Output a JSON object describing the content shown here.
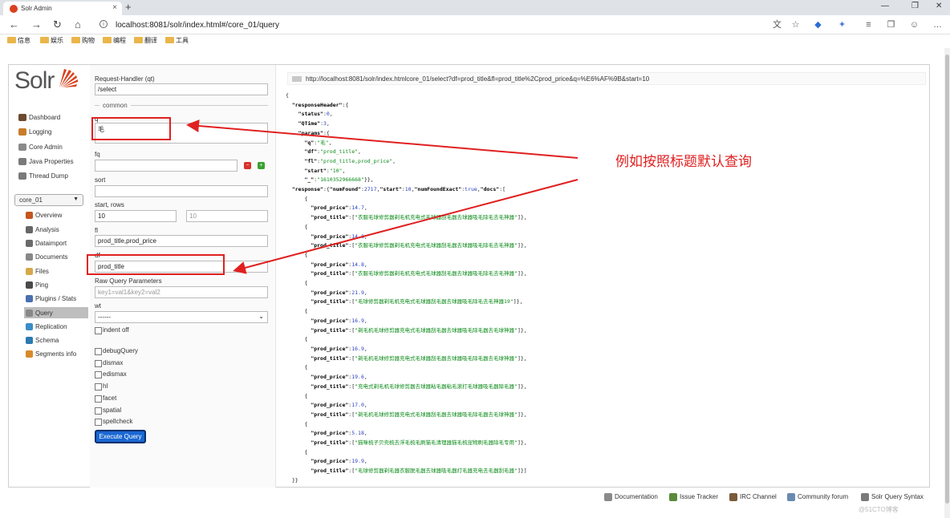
{
  "browser": {
    "tab_title": "Solr Admin",
    "tab_close": "×",
    "new_tab": "+",
    "url": "localhost:8081/solr/index.html#/core_01/query",
    "url_info_icon": "i",
    "bookmarks": [
      "信息",
      "娱乐",
      "购物",
      "编程",
      "翻译",
      "工具"
    ],
    "window_controls": [
      "—",
      "❐",
      "✕"
    ],
    "nav": {
      "back": "←",
      "forward": "→",
      "reload": "↻",
      "home": "⌂"
    }
  },
  "sidebar": {
    "logo_text": "Solr",
    "main_items": [
      {
        "label": "Dashboard",
        "icon": "dashboard-icon",
        "color": "#6b4a2e"
      },
      {
        "label": "Logging",
        "icon": "logging-icon",
        "color": "#c87c2a"
      },
      {
        "label": "Core Admin",
        "icon": "core-admin-icon",
        "color": "#8a8a8a"
      },
      {
        "label": "Java Properties",
        "icon": "java-icon",
        "color": "#7a7a7a"
      },
      {
        "label": "Thread Dump",
        "icon": "thread-dump-icon",
        "color": "#7a7a7a"
      }
    ],
    "core_selector": "core_01",
    "core_items": [
      {
        "label": "Overview",
        "icon": "home-icon",
        "color": "#c4561f"
      },
      {
        "label": "Analysis",
        "icon": "funnel-icon",
        "color": "#666"
      },
      {
        "label": "Dataimport",
        "icon": "dataimport-icon",
        "color": "#6a6a6a"
      },
      {
        "label": "Documents",
        "icon": "documents-icon",
        "color": "#888"
      },
      {
        "label": "Files",
        "icon": "files-icon",
        "color": "#d7a84a"
      },
      {
        "label": "Ping",
        "icon": "ping-icon",
        "color": "#4a4a4a"
      },
      {
        "label": "Plugins / Stats",
        "icon": "plugins-icon",
        "color": "#4a6fb0"
      },
      {
        "label": "Query",
        "icon": "query-icon",
        "color": "#888",
        "active": true
      },
      {
        "label": "Replication",
        "icon": "replication-icon",
        "color": "#3a8dc8"
      },
      {
        "label": "Schema",
        "icon": "schema-icon",
        "color": "#2c7ab0"
      },
      {
        "label": "Segments info",
        "icon": "segments-icon",
        "color": "#d88a2a"
      }
    ]
  },
  "form": {
    "request_handler_label": "Request-Handler (qt)",
    "request_handler_value": "/select",
    "common_label": "common",
    "q_label": "q",
    "q_value": "毛",
    "fq_label": "fq",
    "sort_label": "sort",
    "start_rows_label": "start, rows",
    "start_value": "10",
    "rows_value": "10",
    "fl_label": "fl",
    "fl_value": "prod_title,prod_price",
    "df_label": "df",
    "df_value": "prod_title",
    "raw_label": "Raw Query Parameters",
    "raw_placeholder": "key1=val1&key2=val2",
    "wt_label": "wt",
    "wt_value": "------",
    "indent_off": "indent off",
    "options": [
      "debugQuery",
      "dismax",
      "edismax",
      "hl",
      "facet",
      "spatial",
      "spellcheck"
    ],
    "execute_label": "Execute Query"
  },
  "results": {
    "request_url": "http://localhost:8081/solr/index.htmlcore_01/select?df=prod_title&fl=prod_title%2Cprod_price&q=%E6%AF%9B&start=10",
    "response_header": {
      "status": "0",
      "qtime": "3",
      "q": "毛",
      "df": "prod_title",
      "fl": "prod_title,prod_price",
      "start": "10",
      "underscore": "1610352966668"
    },
    "num_found": "2717",
    "start": "10",
    "num_found_exact": "true",
    "docs": [
      {
        "price": "14.7",
        "title": "衣服毛球修剪器剃毛机充电式毛球器刮毛器去球器吸毛除毛去毛神器"
      },
      {
        "price": "14.8",
        "title": "衣服毛球修剪器剃毛机充电式毛球器刮毛器去球器吸毛除毛去毛神器"
      },
      {
        "price": "14.8",
        "title": "衣服毛球修剪器剃毛机充电式毛球器刮毛器去球器吸毛除毛去毛神器"
      },
      {
        "price": "21.9",
        "title": "毛球修剪器剃毛机充电式毛球器刮毛器去球器吸毛除毛去毛神器19"
      },
      {
        "price": "16.9",
        "title": "剃毛机毛球修剪器充电式毛球器刮毛器去球器吸毛除毛器去毛球神器"
      },
      {
        "price": "16.9",
        "title": "剃毛机毛球修剪器充电式毛球器刮毛器去球器吸毛除毛器去毛球神器"
      },
      {
        "price": "19.6",
        "title": "充电式剃毛机毛球修剪器去球器粘毛器粘毛滚打毛球器吸毛器除毛器"
      },
      {
        "price": "17.0",
        "title": "剃毛机毛球修剪器充电式毛球器刮毛器去球器吸毛除毛器去毛球神器"
      },
      {
        "price": "5.18",
        "title": "猫咪梳子贝壳梳去浮毛梳毛刷猫毛清理器猫毛梳宠物刷毛器除毛专用"
      },
      {
        "price": "19.9",
        "title": "毛球修剪器剃毛器衣服脱毛器去球器吸毛器打毛器充电去毛器刮毛器"
      }
    ]
  },
  "annotation": "例如按照标题默认查询",
  "footer": [
    {
      "label": "Documentation",
      "icon": "documentation-icon"
    },
    {
      "label": "Issue Tracker",
      "icon": "bug-icon"
    },
    {
      "label": "IRC Channel",
      "icon": "irc-icon"
    },
    {
      "label": "Community forum",
      "icon": "mail-icon"
    },
    {
      "label": "Solr Query Syntax",
      "icon": "syntax-icon"
    }
  ],
  "watermark": "@51CTO博客"
}
